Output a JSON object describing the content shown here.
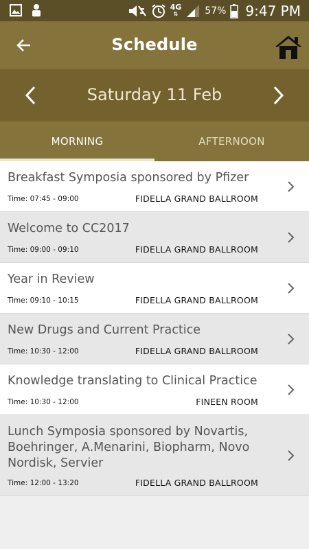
{
  "status_bar": {
    "network": "4G",
    "battery": "57%",
    "time": "9:47 PM"
  },
  "app_bar": {
    "title": "Schedule"
  },
  "date_nav": {
    "date": "Saturday 11 Feb"
  },
  "tabs": [
    {
      "label": "MORNING",
      "active": true
    },
    {
      "label": "AFTERNOON",
      "active": false
    }
  ],
  "sessions": [
    {
      "title": "Breakfast Symposia sponsored by Pfizer",
      "time": "Time: 07:45 - 09:00",
      "room": "FIDELLA GRAND BALLROOM"
    },
    {
      "title": "Welcome to CC2017",
      "time": "Time: 09:00 - 09:10",
      "room": "FIDELLA GRAND BALLROOM"
    },
    {
      "title": "Year in Review",
      "time": "Time: 09:10 - 10:15",
      "room": "FIDELLA GRAND BALLROOM"
    },
    {
      "title": "New Drugs and Current Practice",
      "time": "Time: 10:30 - 12:00",
      "room": "FIDELLA GRAND BALLROOM"
    },
    {
      "title": "Knowledge translating to Clinical Practice",
      "time": "Time: 10:30 - 12:00",
      "room": "FINEEN ROOM"
    },
    {
      "title": "Lunch Symposia sponsored by Novartis, Boehringer, A.Menarini, Biopharm,  Novo Nordisk, Servier",
      "time": "Time: 12:00 - 13:20",
      "room": "FIDELLA GRAND BALLROOM"
    }
  ],
  "colors": {
    "status_bar": "#5b4f28",
    "app_bar": "#85733c",
    "date_bar": "#73612e",
    "tab_indicator": "#efe7c9"
  }
}
